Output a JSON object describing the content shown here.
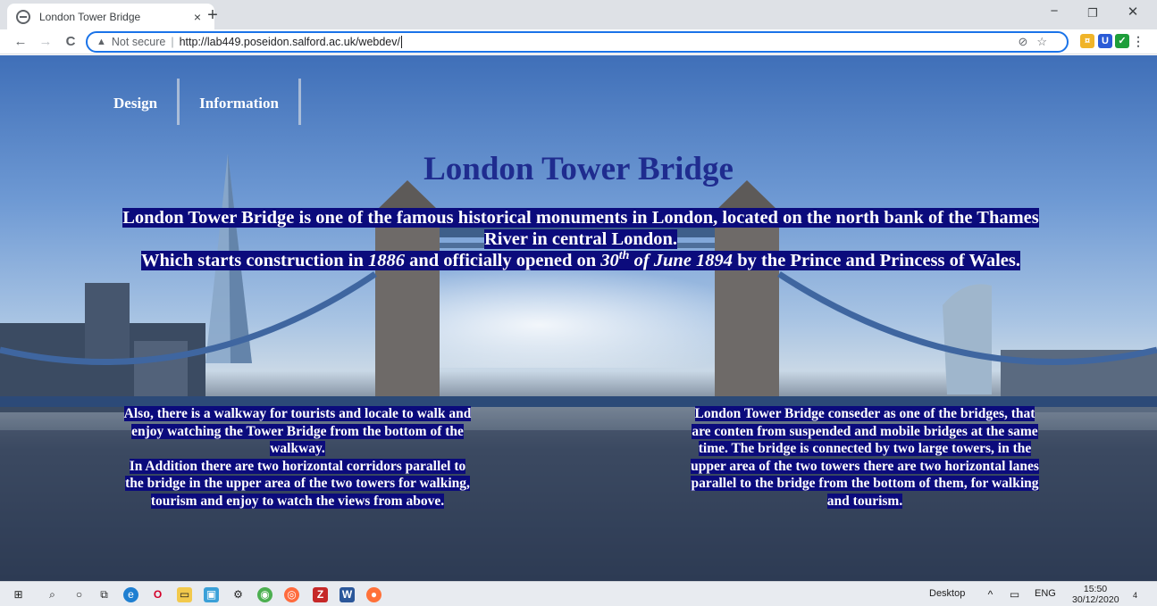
{
  "browser": {
    "tab_title": "London Tower Bridge",
    "tab_close": "×",
    "new_tab": "+",
    "minimize": "−",
    "maximize": "❐",
    "close": "✕",
    "back": "←",
    "forward": "→",
    "reload": "C",
    "security_label": "Not secure",
    "separator": "|",
    "url": "http://lab449.poseidon.salford.ac.uk/webdev/",
    "menu": "⋮"
  },
  "nav": {
    "items": [
      "Design",
      "Information"
    ]
  },
  "page": {
    "title": "London Tower Bridge",
    "intro_line1": "London Tower Bridge is one of the famous historical monuments in London, located on the north bank of the Thames River in central London.",
    "intro_line2_a": "Which starts construction in ",
    "intro_year_start": "1886",
    "intro_line2_b": " and officially opened on ",
    "intro_date_day": "30",
    "intro_date_sup": "th",
    "intro_date_rest": " of June 1894",
    "intro_line2_c": " by the Prince and Princess of Wales.",
    "left_p1": "Also, there is a walkway for tourists and locale to walk and enjoy watching the Tower Bridge from the bottom of the walkway.",
    "left_p2": "In Addition there are two horizontal corridors parallel to the bridge in the upper area of the two towers for walking, tourism and enjoy to watch the views from above.",
    "right_p": "London Tower Bridge conseder as one of the bridges, that are conten from suspended and mobile bridges at the same time. The bridge is connected by two large towers, in the upper area of the two towers there are two horizontal lanes parallel to the bridge from the bottom of them, for walking and tourism."
  },
  "taskbar": {
    "desktop_label": "Desktop",
    "language": "ENG",
    "time": "15:50",
    "date": "30/12/2020",
    "notification_count": "4"
  }
}
